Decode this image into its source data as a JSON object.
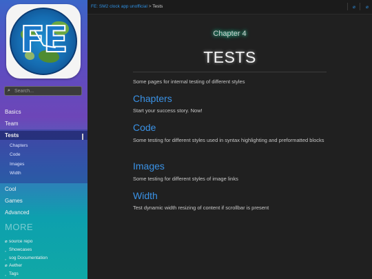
{
  "topbar": {
    "app_link": "FE: SM2 clock app unofficial",
    "separator": ">",
    "current": "Tests",
    "icons": [
      "menu-icon",
      "nav-icon"
    ]
  },
  "sidebar": {
    "search_placeholder": "Search...",
    "nav": [
      {
        "label": "Basics"
      },
      {
        "label": "Team"
      },
      {
        "label": "Tests",
        "active": true
      },
      {
        "label": "Cool"
      },
      {
        "label": "Games"
      },
      {
        "label": "Advanced"
      }
    ],
    "sub_items": [
      "Chapters",
      "Code",
      "Images",
      "Width"
    ],
    "more_label": "MORE",
    "links": [
      "source repo",
      "Showcases",
      "sog Documentation",
      "Aether",
      "Tags"
    ]
  },
  "main": {
    "chapter": "Chapter 4",
    "title": "TESTS",
    "intro": "Some pages for internal testing of different styles",
    "sections": [
      {
        "heading": "Chapters",
        "text": "Start your success story. Now!"
      },
      {
        "heading": "Code",
        "text": "Some testing for different styles used in syntax highlighting and preformatted blocks"
      },
      {
        "heading": "Images",
        "text": "Some testing for different styles of image links"
      },
      {
        "heading": "Width",
        "text": "Test dynamic width resizing of content if scrollbar is present"
      }
    ]
  },
  "colors": {
    "accent": "#3a92e6",
    "background": "#202020",
    "chapter_glow": "#2ad4a0"
  }
}
